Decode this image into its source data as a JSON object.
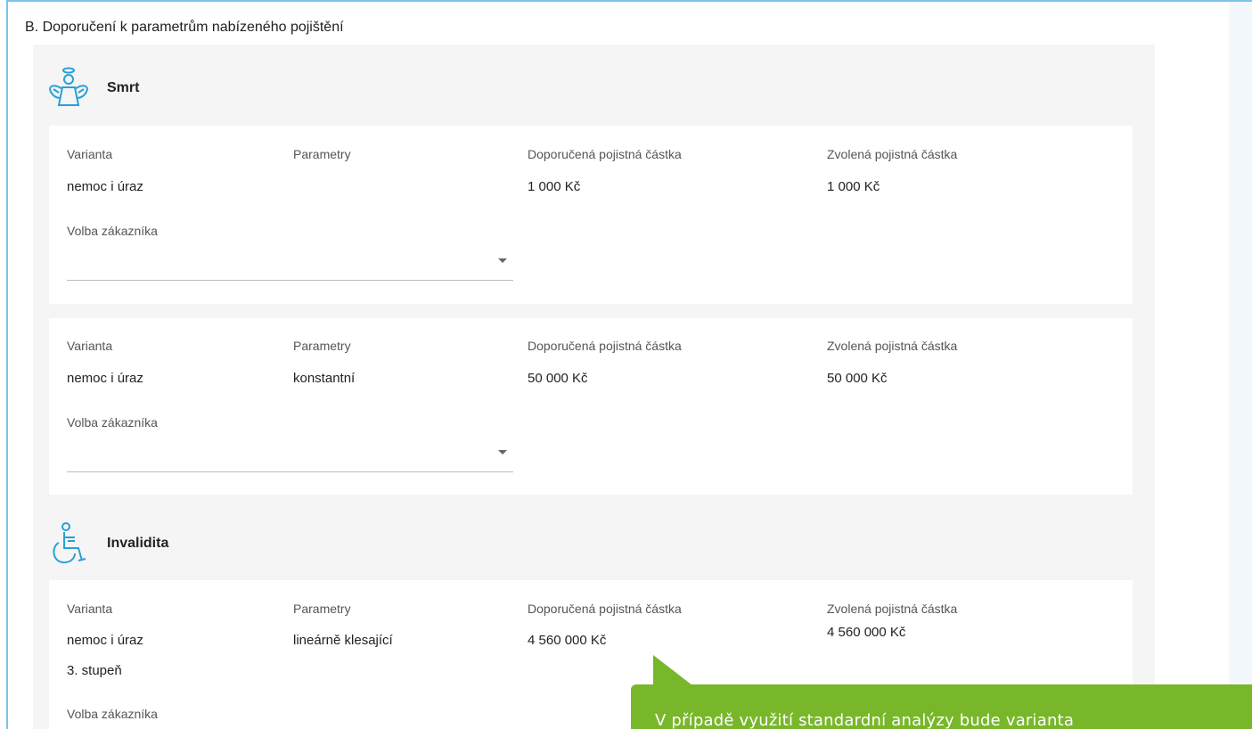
{
  "section": {
    "title": "B. Doporučení k parametrům nabízeného pojištění"
  },
  "groups": [
    {
      "title": "Smrt",
      "icon": "angel-icon",
      "cards": [
        {
          "labels": {
            "variant": "Varianta",
            "params": "Parametry",
            "recommended": "Doporučená pojistná částka",
            "chosen": "Zvolená pojistná částka"
          },
          "variant": "nemoc i úraz",
          "params": "",
          "recommended": "1 000 Kč",
          "chosen": "1 000 Kč",
          "customer_choice_label": "Volba zákazníka",
          "customer_choice_value": ""
        },
        {
          "labels": {
            "variant": "Varianta",
            "params": "Parametry",
            "recommended": "Doporučená pojistná částka",
            "chosen": "Zvolená pojistná částka"
          },
          "variant": "nemoc i úraz",
          "params": "konstantní",
          "recommended": "50 000 Kč",
          "chosen": "50 000 Kč",
          "customer_choice_label": "Volba zákazníka",
          "customer_choice_value": ""
        }
      ]
    },
    {
      "title": "Invalidita",
      "icon": "wheelchair-icon",
      "cards": [
        {
          "labels": {
            "variant": "Varianta",
            "params": "Parametry",
            "recommended": "Doporučená pojistná částka",
            "chosen": "Zvolená pojistná částka"
          },
          "variant": "nemoc i úraz",
          "variant_extra": "3. stupeň",
          "params": "lineárně klesající",
          "recommended": "4 560 000 Kč",
          "chosen": "4 560 000 Kč",
          "customer_choice_label": "Volba zákazníka"
        }
      ]
    }
  ],
  "tooltip": {
    "text": "V případě využití standardní analýzy bude varianta"
  },
  "colors": {
    "accent_blue": "#7cc3ec",
    "icon_blue": "#2a9fd6",
    "tooltip_green": "#78b72a"
  }
}
